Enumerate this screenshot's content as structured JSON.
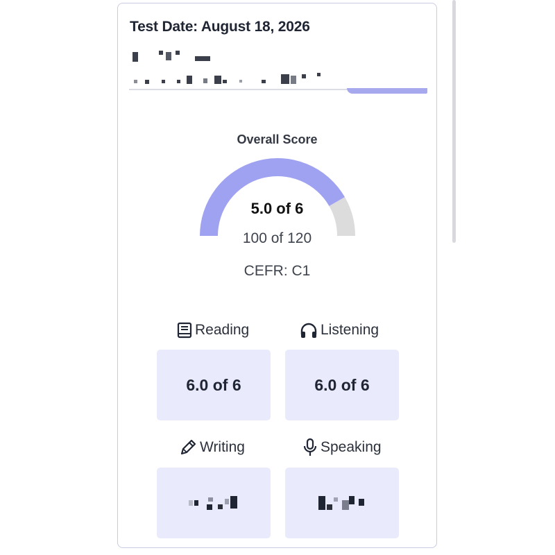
{
  "header": {
    "test_date": "Test Date: August 18, 2026"
  },
  "overall": {
    "title": "Overall Score",
    "score": "5.0 of 6",
    "scale_score": "100 of 120",
    "cefr": "CEFR: C1",
    "gauge_fraction": 0.8333,
    "fill_color": "#9fa2f0",
    "track_color": "#dcdcdc"
  },
  "skills": {
    "reading": {
      "label": "Reading",
      "icon": "book-icon",
      "score": "6.0 of 6"
    },
    "listening": {
      "label": "Listening",
      "icon": "headphones-icon",
      "score": "6.0 of 6"
    },
    "writing": {
      "label": "Writing",
      "icon": "pencil-icon",
      "score": ""
    },
    "speaking": {
      "label": "Speaking",
      "icon": "microphone-icon",
      "score": ""
    }
  },
  "colors": {
    "card_border": "#c9cbe4",
    "score_box_bg": "#e9eafb",
    "accent": "#a7a9ee"
  }
}
